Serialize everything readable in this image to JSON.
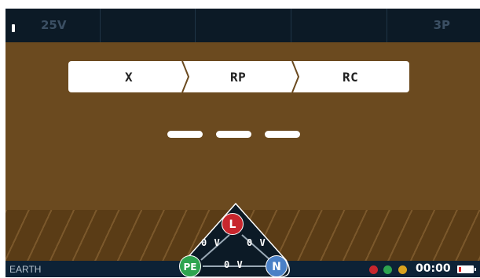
{
  "topbar": {
    "voltage": "25V",
    "phase": "3P"
  },
  "selector": {
    "segments": [
      "X",
      "RP",
      "RC"
    ]
  },
  "bottombar": {
    "mode": "EARTH",
    "time": "00:00",
    "status_colors": [
      "#c8262d",
      "#2ea44f",
      "#d9a21e"
    ]
  },
  "terminals": {
    "line": "L",
    "protective_earth": "PE",
    "neutral": "N",
    "v_l_pe": "0 V",
    "v_l_n": "0 V",
    "v_pe_n": "0 V"
  },
  "colors": {
    "background": "#6b4a1f",
    "bar": "#0c1a26",
    "line_node": "#c8262d",
    "pe_node": "#2ea44f",
    "n_node": "#4a80c6"
  }
}
